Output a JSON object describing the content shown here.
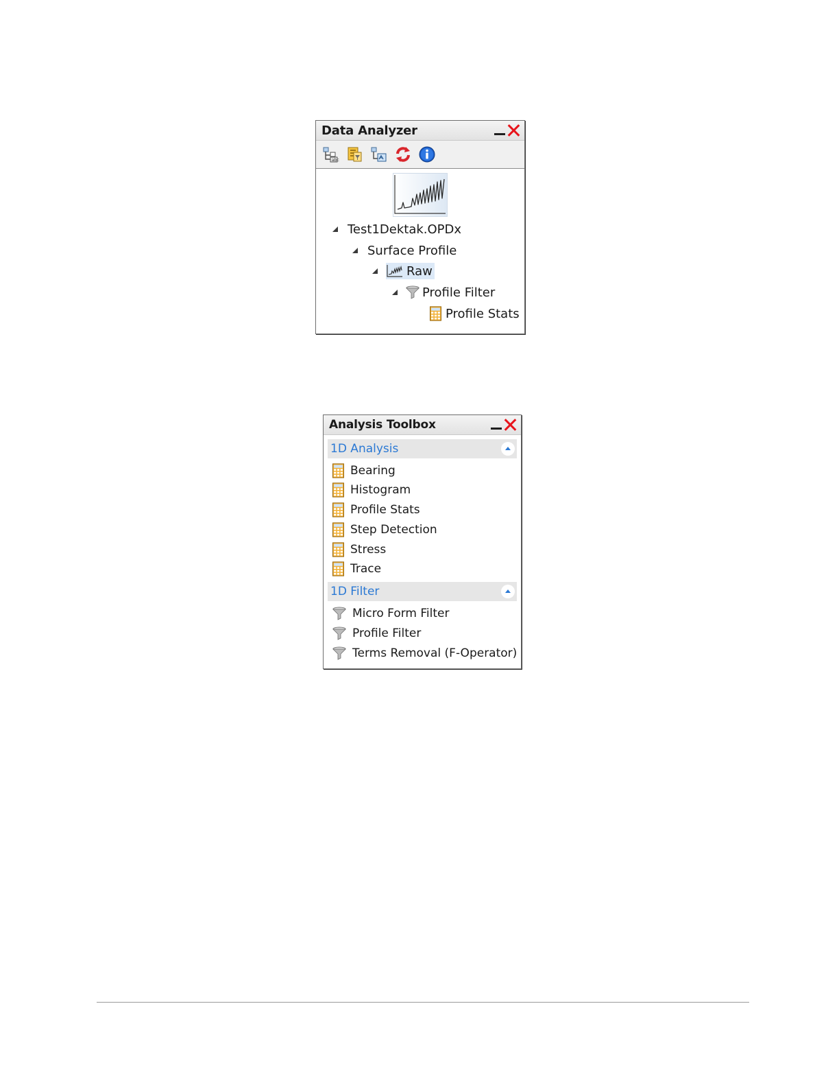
{
  "data_analyzer": {
    "title": "Data Analyzer",
    "toolbar": [
      {
        "icon": "add-analysis-icon"
      },
      {
        "icon": "add-filter-icon"
      },
      {
        "icon": "add-data-icon"
      },
      {
        "icon": "refresh-icon"
      },
      {
        "icon": "info-icon"
      }
    ],
    "thumbnail_icon": "profile-chart-thumbnail",
    "tree": {
      "file": "Test1Dektak.OPDx",
      "surface_profile": "Surface Profile",
      "raw": "Raw",
      "profile_filter": "Profile Filter",
      "profile_stats": "Profile Stats"
    }
  },
  "analysis_toolbox": {
    "title": "Analysis Toolbox",
    "sections": [
      {
        "title": "1D Analysis",
        "icon": "calculator-icon",
        "items": [
          "Bearing",
          "Histogram",
          "Profile Stats",
          "Step Detection",
          "Stress",
          "Trace"
        ]
      },
      {
        "title": "1D Filter",
        "icon": "funnel-icon",
        "items": [
          "Micro Form Filter",
          "Profile Filter",
          "Terms Removal (F-Operator)"
        ]
      }
    ]
  },
  "colors": {
    "close": "#e8141b",
    "section_title": "#2b79d4",
    "selection": "#dce9f7"
  }
}
